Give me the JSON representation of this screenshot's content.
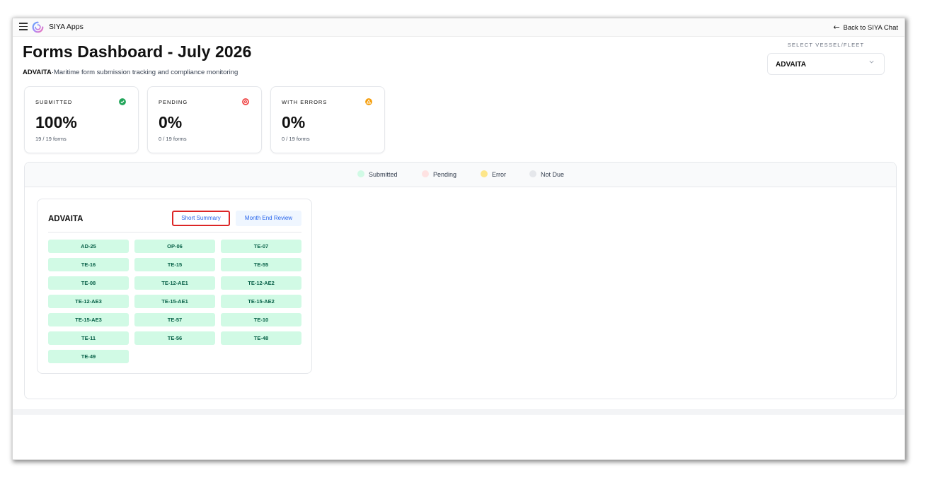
{
  "app": {
    "name": "SIYA Apps",
    "back_label": "Back to SIYA Chat"
  },
  "header": {
    "title": "Forms Dashboard - July 2026",
    "vessel": "ADVAITA",
    "subtitle": "·Maritime form submission tracking and compliance monitoring"
  },
  "vessel_select": {
    "label": "SELECT VESSEL/FLEET",
    "value": "ADVAITA"
  },
  "stats": [
    {
      "label": "SUBMITTED",
      "value": "100%",
      "count": "19 / 19 forms",
      "color": "#22a55a"
    },
    {
      "label": "PENDING",
      "value": "0%",
      "count": "0 / 19 forms",
      "color": "#ef4444"
    },
    {
      "label": "WITH ERRORS",
      "value": "0%",
      "count": "0 / 19 forms",
      "color": "#f59e0b"
    }
  ],
  "legend": [
    {
      "label": "Submitted",
      "color": "#d1fae5"
    },
    {
      "label": "Pending",
      "color": "#fee2e2"
    },
    {
      "label": "Error",
      "color": "#fde68a"
    },
    {
      "label": "Not Due",
      "color": "#e5e7eb"
    }
  ],
  "vessel_card": {
    "name": "ADVAITA",
    "short_summary": "Short Summary",
    "month_end_review": "Month End Review",
    "forms": [
      "AD-25",
      "OP-06",
      "TE-07",
      "TE-16",
      "TE-15",
      "TE-55",
      "TE-08",
      "TE-12-AE1",
      "TE-12-AE2",
      "TE-12-AE3",
      "TE-15-AE1",
      "TE-15-AE2",
      "TE-15-AE3",
      "TE-57",
      "TE-10",
      "TE-11",
      "TE-56",
      "TE-48",
      "TE-49"
    ],
    "form_status": "submitted"
  }
}
